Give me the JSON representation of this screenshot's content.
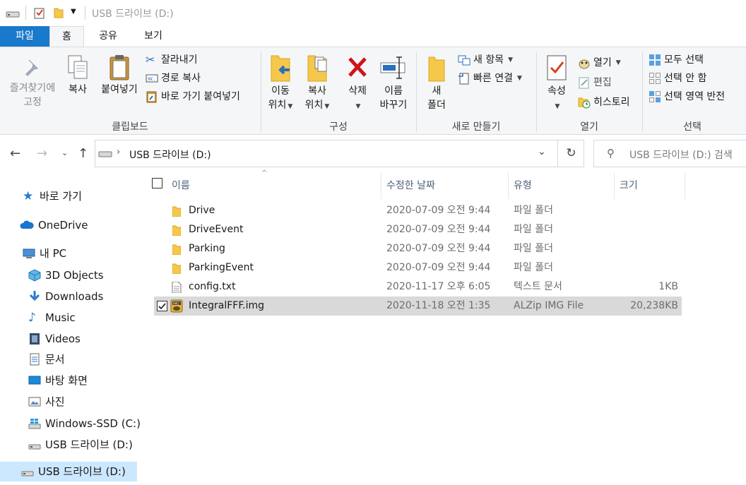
{
  "window": {
    "title": "USB 드라이브 (D:)"
  },
  "ribbon_tabs": [
    "파일",
    "홈",
    "공유",
    "보기"
  ],
  "ribbon": {
    "clipboard": {
      "pin_label_1": "즐겨찾기에",
      "pin_label_2": "고정",
      "copy": "복사",
      "paste": "붙여넣기",
      "cut": "잘라내기",
      "copy_path": "경로 복사",
      "paste_shortcut": "바로 가기 붙여넣기",
      "group": "클립보드"
    },
    "organize": {
      "move_1": "이동",
      "move_2": "위치",
      "copyto_1": "복사",
      "copyto_2": "위치",
      "delete": "삭제",
      "rename_1": "이름",
      "rename_2": "바꾸기",
      "group": "구성"
    },
    "new": {
      "new_folder_1": "새",
      "new_folder_2": "폴더",
      "new_item": "새 항목",
      "easy_access": "빠른 연결",
      "group": "새로 만들기"
    },
    "open": {
      "properties": "속성",
      "open": "열기",
      "edit": "편집",
      "history": "히스토리",
      "group": "열기"
    },
    "select": {
      "select_all": "모두 선택",
      "select_none": "선택 안 함",
      "invert": "선택 영역 반전",
      "group": "선택"
    }
  },
  "address": {
    "path": "USB 드라이브 (D:)",
    "search_placeholder": "USB 드라이브 (D:) 검색"
  },
  "nav": {
    "items": [
      {
        "label": "바로 가기",
        "icon": "star-icon"
      },
      {
        "label": "OneDrive",
        "icon": "cloud-icon"
      },
      {
        "label": "내 PC",
        "icon": "pc-icon"
      },
      {
        "label": "3D Objects",
        "icon": "cube-icon"
      },
      {
        "label": "Downloads",
        "icon": "download-icon"
      },
      {
        "label": "Music",
        "icon": "music-icon"
      },
      {
        "label": "Videos",
        "icon": "video-icon"
      },
      {
        "label": "문서",
        "icon": "document-icon"
      },
      {
        "label": "바탕 화면",
        "icon": "desktop-icon"
      },
      {
        "label": "사진",
        "icon": "picture-icon"
      },
      {
        "label": "Windows-SSD (C:)",
        "icon": "windows-drive-icon"
      },
      {
        "label": "USB 드라이브 (D:)",
        "icon": "usb-drive-icon"
      },
      {
        "label": "USB 드라이브 (D:)",
        "icon": "usb-drive-icon"
      }
    ]
  },
  "columns": {
    "name": "이름",
    "date": "수정한 날짜",
    "type": "유형",
    "size": "크기"
  },
  "files": [
    {
      "name": "Drive",
      "date": "2020-07-09 오전 9:44",
      "type": "파일 폴더",
      "size": "",
      "icon": "folder-icon"
    },
    {
      "name": "DriveEvent",
      "date": "2020-07-09 오전 9:44",
      "type": "파일 폴더",
      "size": "",
      "icon": "folder-icon"
    },
    {
      "name": "Parking",
      "date": "2020-07-09 오전 9:44",
      "type": "파일 폴더",
      "size": "",
      "icon": "folder-icon"
    },
    {
      "name": "ParkingEvent",
      "date": "2020-07-09 오전 9:44",
      "type": "파일 폴더",
      "size": "",
      "icon": "folder-icon"
    },
    {
      "name": "config.txt",
      "date": "2020-11-17 오후 6:05",
      "type": "텍스트 문서",
      "size": "1KB",
      "icon": "text-file-icon"
    },
    {
      "name": "IntegralFFF.img",
      "date": "2020-11-18 오전 1:35",
      "type": "ALZip IMG File",
      "size": "20,238KB",
      "icon": "img-file-icon",
      "selected": true
    }
  ],
  "colors": {
    "file_tab": "#1979ca",
    "ribbon_bg": "#f5f6f7",
    "selection": "#d9d9d9",
    "nav_selection": "#cce8ff",
    "folder": "#f5c74a"
  }
}
